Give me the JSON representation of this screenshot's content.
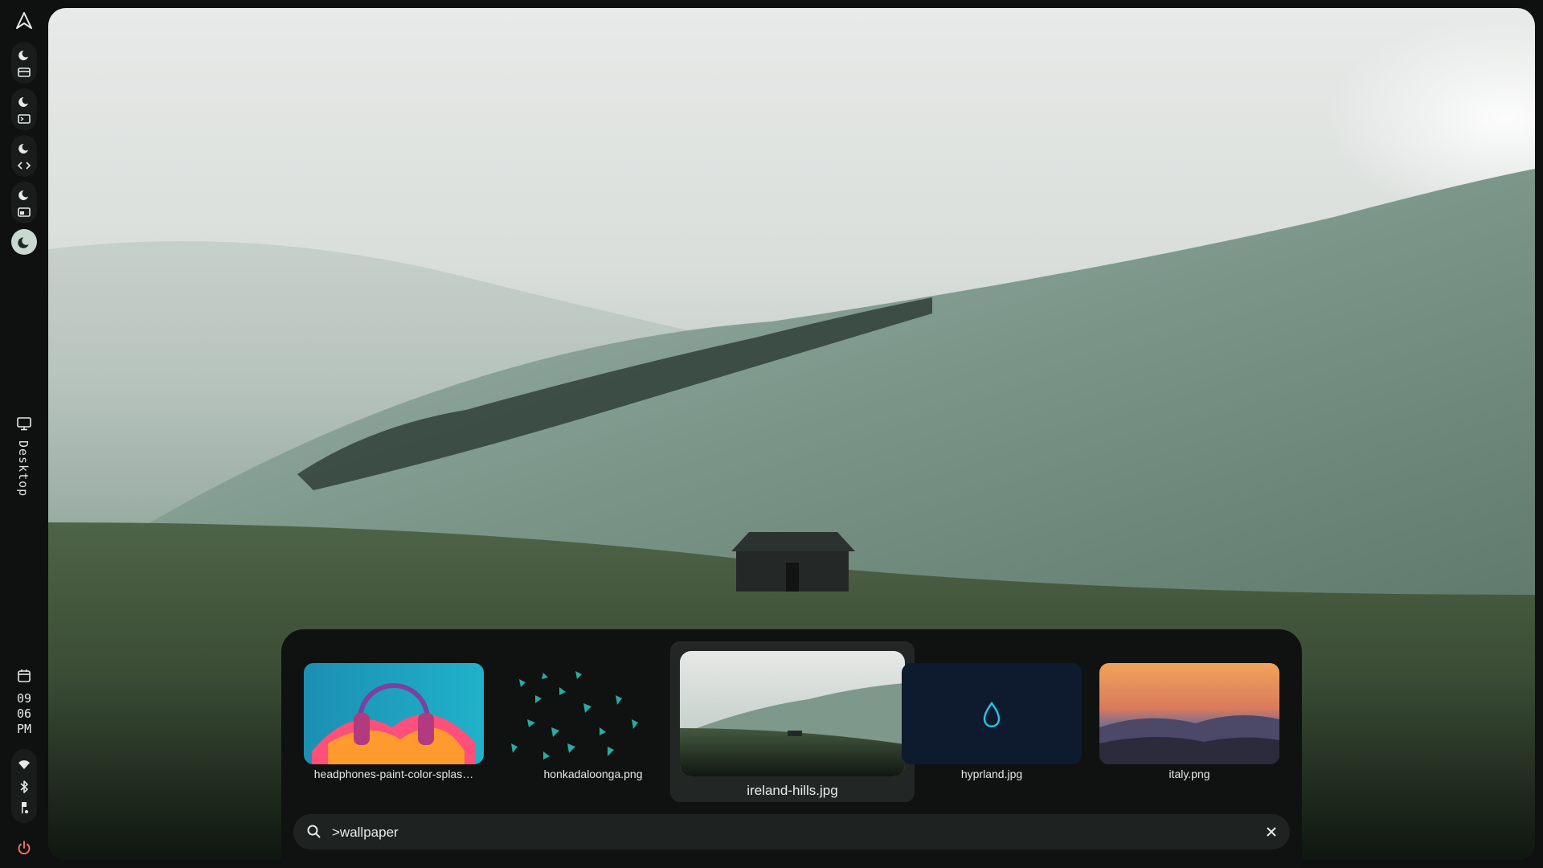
{
  "desktop": {
    "workspace_label": "Desktop",
    "clock": {
      "hour": "09",
      "minute": "06",
      "ampm": "PM"
    }
  },
  "launcher": {
    "wallpapers": [
      {
        "name": "headphones-paint-color-splas…"
      },
      {
        "name": "honkadaloonga.png"
      },
      {
        "name": "ireland-hills.jpg",
        "selected": true
      },
      {
        "name": "hyprland.jpg"
      },
      {
        "name": "italy.png"
      }
    ],
    "search": {
      "value": ">wallpaper"
    }
  },
  "colors": {
    "background": "#0e1110",
    "panel": "#0f1211",
    "search_bg": "#1e2321",
    "active_workspace": "#c9d8d1",
    "text": "#e5e9e6"
  },
  "icons": [
    "app-logo-icon",
    "moon-icon",
    "browser-icon",
    "terminal-icon",
    "code-icon",
    "files-icon",
    "monitor-icon",
    "calendar-icon",
    "wifi-icon",
    "bluetooth-icon",
    "notifications-icon",
    "power-icon",
    "search-icon",
    "close-icon"
  ]
}
